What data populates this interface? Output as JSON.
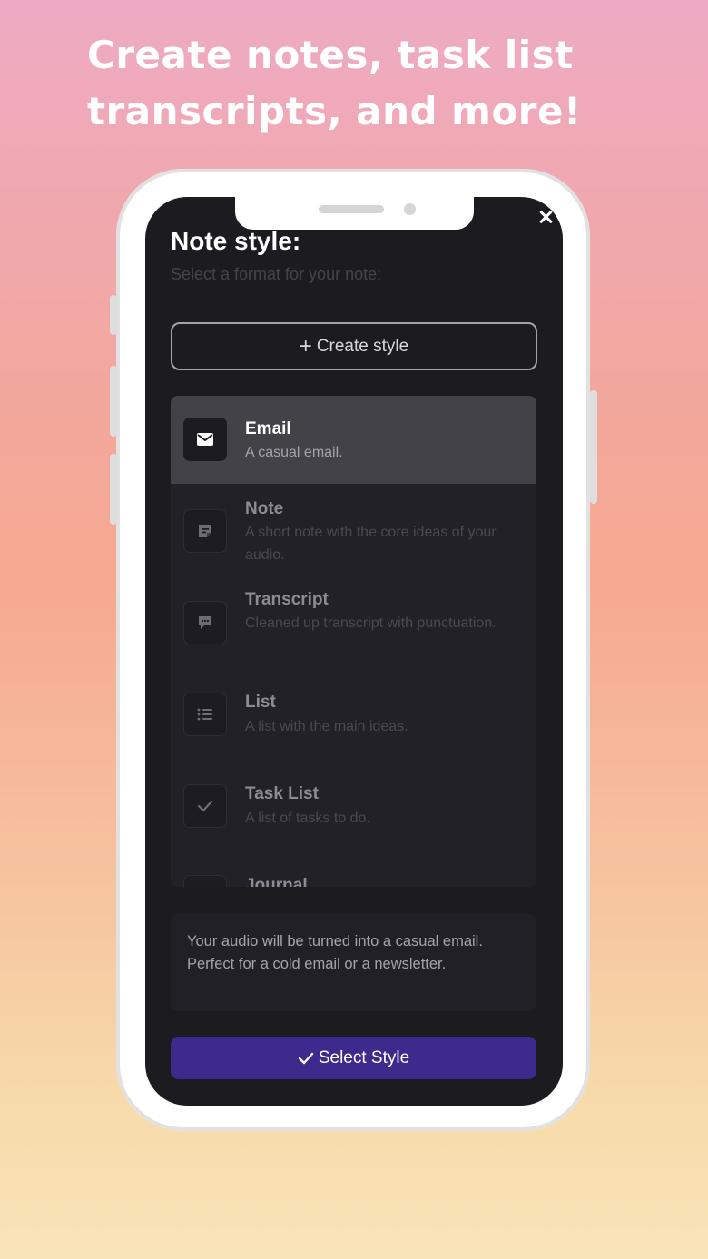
{
  "headline": {
    "line1": "Create notes, task list",
    "line2": "transcripts, and more!"
  },
  "modal": {
    "title": "Note style:",
    "subtitle": "Select a format for your note:",
    "create_button_label": "Create style",
    "styles": [
      {
        "name": "Email",
        "description": "A casual email.",
        "icon": "envelope-icon",
        "selected": true
      },
      {
        "name": "Note",
        "description": "A short note with the core ideas of your audio.",
        "icon": "sticky-note-icon",
        "selected": false
      },
      {
        "name": "Transcript",
        "description": "Cleaned up transcript with punctuation.",
        "icon": "speech-bubble-icon",
        "selected": false
      },
      {
        "name": "List",
        "description": "A list with the main ideas.",
        "icon": "bullet-list-icon",
        "selected": false
      },
      {
        "name": "Task List",
        "description": "A list of tasks to do.",
        "icon": "checkmark-icon",
        "selected": false
      },
      {
        "name": "Journal",
        "description": "",
        "icon": "journal-icon",
        "selected": false
      }
    ],
    "info_text": "Your audio will be turned into a casual email. Perfect for a cold email or a newsletter.",
    "select_button_label": "Select Style"
  },
  "colors": {
    "accent": "#3d2a8c",
    "screen_bg": "#1c1b20",
    "selected_row": "#434248"
  }
}
